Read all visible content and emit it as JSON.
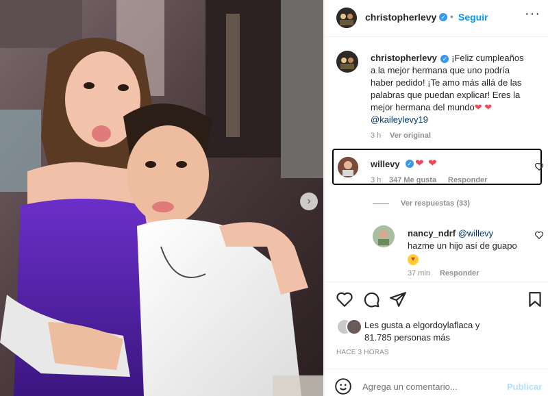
{
  "post": {
    "author": "christopherlevy",
    "follow_label": "Seguir",
    "caption_lines": [
      "¡Feliz cumpleaños",
      "a la mejor hermana que uno podría",
      "haber pedido! ¡Te amo más allá de las",
      "palabras que puedan explicar! Eres la",
      "mejor hermana del mundo"
    ],
    "caption_mention": "@kaileylevy19",
    "caption_time": "3 h",
    "see_original": "Ver original"
  },
  "comments": [
    {
      "username": "willevy",
      "time": "3 h",
      "likes": "347 Me gusta",
      "reply": "Responder",
      "view_replies": "Ver respuestas (33)"
    },
    {
      "username": "nancy_ndrf",
      "mention": "@willevy",
      "text": "hazme un hijo así de guapo",
      "time": "37 min",
      "reply": "Responder"
    }
  ],
  "likes": {
    "liked_by": "Les gusta a",
    "liked_by_user": "elgordoylaflaca",
    "liked_by_suffix": "y",
    "count_line": "81.785 personas más"
  },
  "timestamp": "HACE 3 HORAS",
  "comment_box": {
    "placeholder": "Agrega un comentario...",
    "publish_label": "Publicar"
  },
  "icons": [
    "verified-icon",
    "more-options-icon",
    "heart-icon",
    "comment-icon",
    "share-icon",
    "bookmark-icon",
    "emoji-icon",
    "next-arrow-icon"
  ],
  "colors": {
    "accent": "#0095f6",
    "heart": "#ed4956",
    "verified": "#3897f0",
    "muted": "#8e8e8e",
    "highlight_box": "#000000"
  }
}
